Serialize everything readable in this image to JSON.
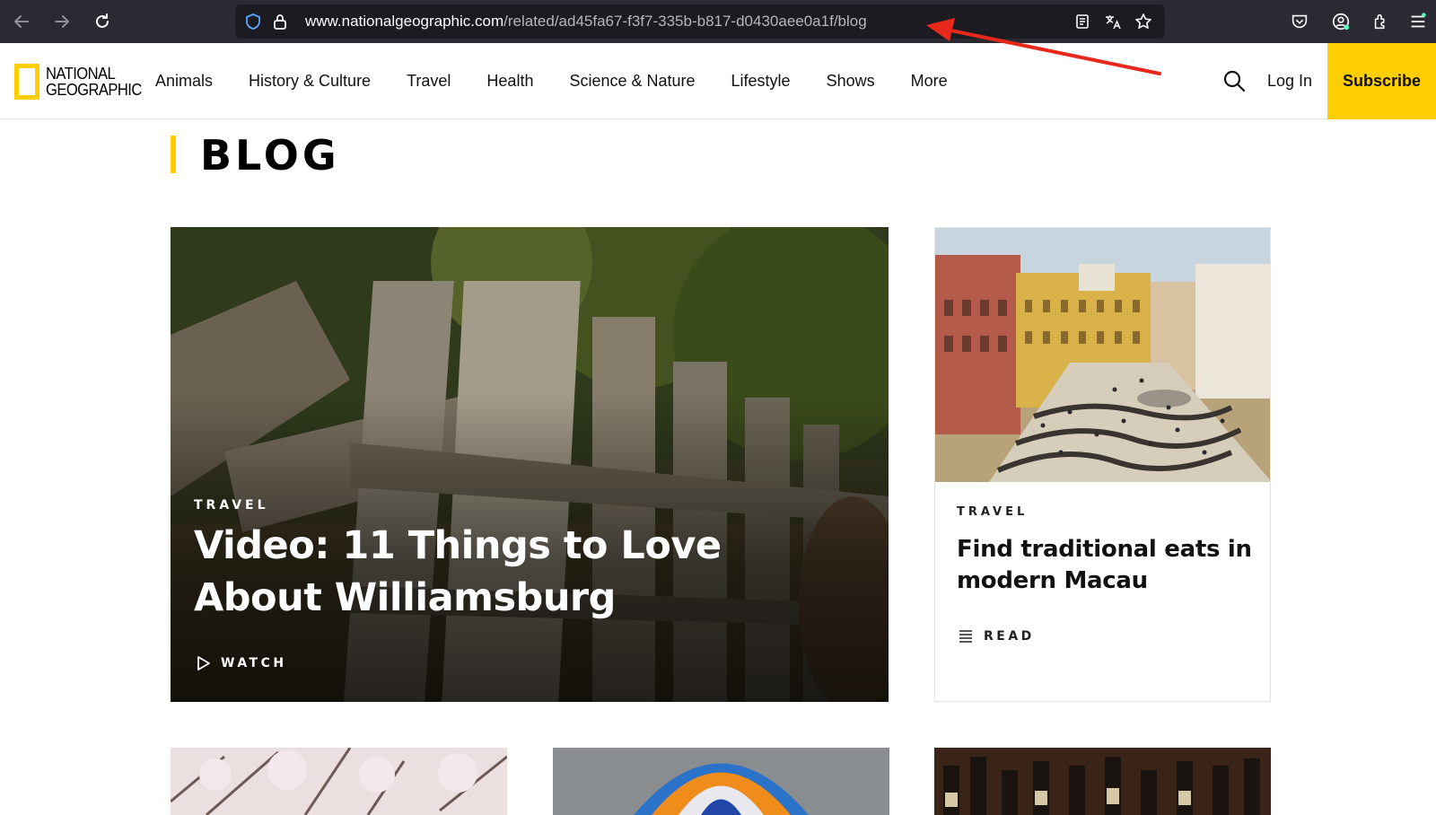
{
  "browser": {
    "url_host": "www.nationalgeographic.com",
    "url_path": "/related/ad45fa67-f3f7-335b-b817-d0430aee0a1f/blog",
    "icons": [
      "back-arrow-icon",
      "forward-arrow-icon",
      "reload-icon",
      "shield-icon",
      "lock-icon",
      "reader-view-icon",
      "translate-icon",
      "bookmark-star-icon",
      "pocket-icon",
      "account-icon",
      "extensions-icon",
      "menu-icon"
    ]
  },
  "header": {
    "logo_line1": "NATIONAL",
    "logo_line2": "GEOGRAPHIC",
    "nav": [
      "Animals",
      "History & Culture",
      "Travel",
      "Health",
      "Science & Nature",
      "Lifestyle",
      "Shows",
      "More"
    ],
    "login_label": "Log In",
    "subscribe_label": "Subscribe",
    "accent_color": "#ffce00"
  },
  "page": {
    "title": "BLOG"
  },
  "feature_card": {
    "kicker": "TRAVEL",
    "headline": "Video: 11 Things to Love About Williamsburg",
    "cta": "WATCH"
  },
  "side_card": {
    "kicker": "TRAVEL",
    "headline": "Find traditional eats in modern Macau",
    "cta": "READ"
  }
}
